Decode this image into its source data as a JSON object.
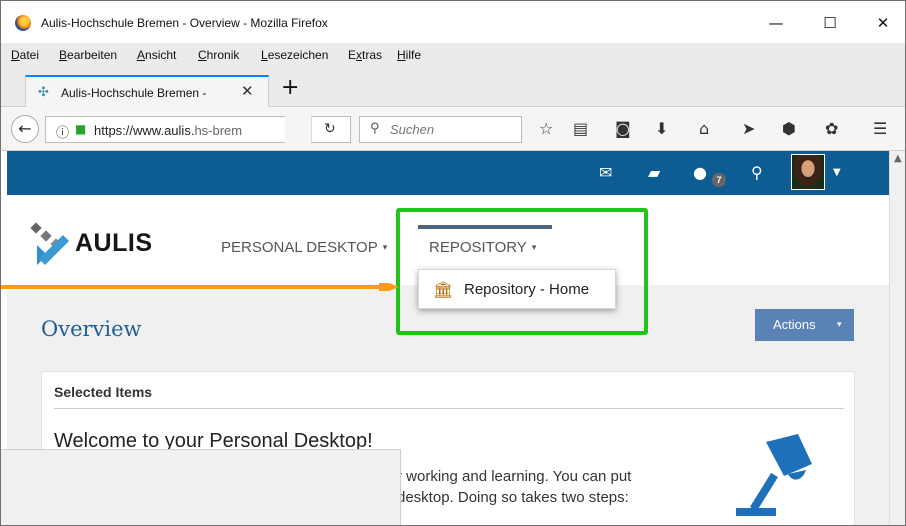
{
  "browser": {
    "window_title": "Aulis-Hochschule Bremen - Overview - Mozilla Firefox",
    "controls": {
      "minimize": "—",
      "maximize": "☐",
      "close": "✕"
    },
    "menu": [
      "Datei",
      "Bearbeiten",
      "Ansicht",
      "Chronik",
      "Lesezeichen",
      "Extras",
      "Hilfe"
    ],
    "menu_underline": [
      "D",
      "B",
      "A",
      "C",
      "L",
      "x",
      "H"
    ],
    "tab": {
      "title": "Aulis-Hochschule Bremen -",
      "close": "✕"
    },
    "new_tab": "+",
    "url_main": "https://www.aulis.",
    "url_rest": "hs-brem",
    "search_placeholder": "Suchen"
  },
  "site": {
    "logo_text": "AULIS",
    "notifications_badge": "7",
    "nav": [
      {
        "label": "PERSONAL DESKTOP",
        "caret": "▾"
      },
      {
        "label": "REPOSITORY",
        "caret": "▾"
      }
    ],
    "dropdown_item": "Repository - Home",
    "page_title": "Overview",
    "actions_label": "Actions",
    "actions_caret": "▾",
    "card_title": "Selected Items",
    "welcome_heading": "Welcome to your Personal Desktop!",
    "body_line1": "r working and learning. You can put",
    "body_line2": "desktop. Doing so takes two steps:"
  },
  "colors": {
    "topbar": "#0d5d93",
    "highlight": "#22c41b",
    "arrow": "#ff9a16",
    "title_blue": "#1f5f97",
    "actions_button": "#5a82b4"
  }
}
